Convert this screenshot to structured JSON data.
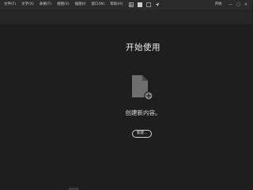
{
  "menubar": {
    "items": [
      {
        "label": "文件(F)"
      },
      {
        "label": "文字(X)"
      },
      {
        "label": "表格(T)"
      },
      {
        "label": "视图(V)"
      },
      {
        "label": "插图(I)"
      },
      {
        "label": "窗口(W)"
      },
      {
        "label": "帮助(H)"
      }
    ],
    "tools": [
      {
        "icon": "grid-icon"
      },
      {
        "icon": "frame-selected-icon"
      },
      {
        "icon": "box-icon"
      },
      {
        "icon": "send-icon"
      }
    ],
    "right_label": "开始",
    "window_controls": [
      "—",
      "□",
      "✕"
    ]
  },
  "welcome": {
    "title": "开始使用",
    "create_text": "创建新内容。",
    "new_button_label": "新建..."
  },
  "colors": {
    "background": "#1e1e1e",
    "menubar": "#2b2b2b",
    "text": "#e6e6e6",
    "icon": "#6e6e6e"
  }
}
